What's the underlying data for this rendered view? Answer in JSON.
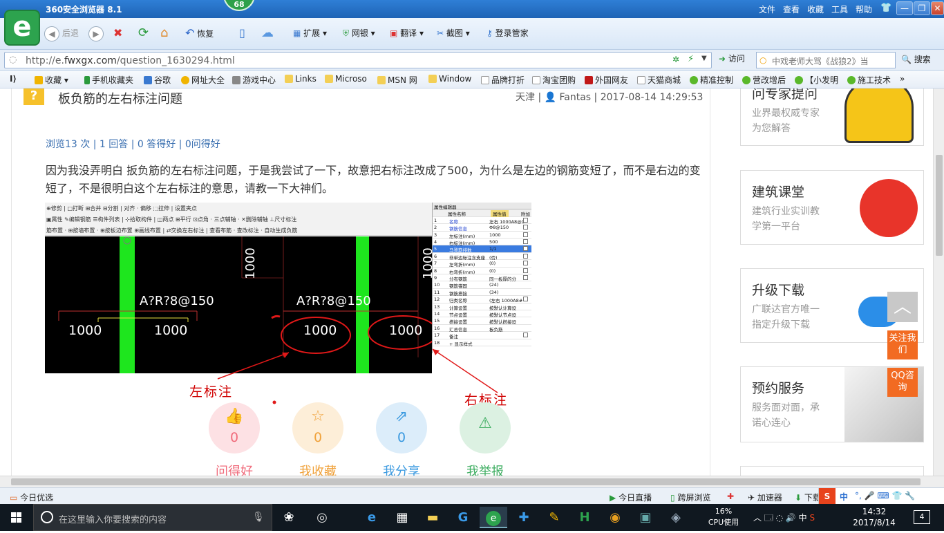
{
  "browser": {
    "title": "360安全浏览器 8.1",
    "badge_count": "68",
    "menu": [
      "文件",
      "查看",
      "收藏",
      "工具",
      "帮助"
    ],
    "toolbar": {
      "back": "后退",
      "restore": "恢复",
      "extensions": "扩展",
      "online_banking": "网银",
      "translate": "翻译",
      "screenshot": "截图",
      "login_manager": "登录管家"
    },
    "address": {
      "url_prefix": "http://e.",
      "url_domain": "fwxgx.com",
      "url_path": "/question_1630294.html",
      "visit_label": "访问",
      "search_placeholder": "中戏老师大骂《战狼2》当",
      "search_button": "搜索"
    },
    "favorites": [
      "收藏",
      "手机收藏夹",
      "谷歌",
      "网址大全",
      "游戏中心",
      "Links",
      "Microso",
      "MSN 网",
      "Window",
      "品牌打折",
      "淘宝团购",
      "外国网友",
      "天猫商城",
      "精准控制",
      "营改增后",
      "【小发明",
      "施工技术"
    ]
  },
  "question": {
    "title": "板负筋的左右标注问题",
    "meta": "天津 | 👤 Fantas | 2017-08-14 14:29:53",
    "stats": "浏览13 次 | 1 回答 | 0 答得好 | 0问得好",
    "body": "因为我没弄明白 扳负筋的左右标注问题，于是我尝试了一下，故意把右标注改成了500，为什么是左边的钢筋变短了，而不是右边的变短了，不是很明白这个左右标注的意思，请教一下大神们。",
    "image": {
      "toolbar_rows": [
        "⊕修剪 | □打断 ⊞合并 ⊟分割 | 对齐 · 偏移 ⬚拉伸 | 设置夹点",
        "▣属性 ✎编辑钢筋 ☰构件列表 | ⊹拾取构件 | ◫两点 ⊞平行 ⊡点角 · 三点辅轴 · ✕删除辅轴 ⊥尺寸标注",
        "筋布置 · ⊞按墙布置 · ⊞按板边布置 ⊞画线布置 | ⇄交换左右标注 | 查看布筋 · 查改标注 · 自动生成负筋"
      ],
      "cad_labels": {
        "rebar_left": "A?R?8@150",
        "rebar_right": "A?R?8@150",
        "vertical_left": "1000",
        "vertical_right": "1000",
        "dim_1": "1000",
        "dim_2": "1000",
        "dim_3": "1000",
        "dim_4": "1000"
      },
      "props_header": "属性编辑器",
      "props_columns": [
        "属性名称",
        "属性值",
        "附加"
      ],
      "props_rows": [
        {
          "n": "1",
          "name": "名称",
          "value": "左右 1000A8@1"
        },
        {
          "n": "2",
          "name": "钢筋信息",
          "value": "Φ8@150"
        },
        {
          "n": "3",
          "name": "左标注(mm)",
          "value": "1000"
        },
        {
          "n": "4",
          "name": "右标注(mm)",
          "value": "500"
        },
        {
          "n": "5",
          "name": "马凳筋排数",
          "value": "1/1"
        },
        {
          "n": "6",
          "name": "非单边标注含支座",
          "value": "(否)"
        },
        {
          "n": "7",
          "name": "左弯折(mm)",
          "value": "(0)"
        },
        {
          "n": "8",
          "name": "右弯折(mm)",
          "value": "(0)"
        },
        {
          "n": "9",
          "name": "分布钢筋",
          "value": "同一板厚的分"
        },
        {
          "n": "10",
          "name": "钢筋锚固",
          "value": "(24)"
        },
        {
          "n": "11",
          "name": "钢筋搭接",
          "value": "(34)"
        },
        {
          "n": "12",
          "name": "归类名称",
          "value": "(左右 1000A8#"
        },
        {
          "n": "13",
          "name": "计算设置",
          "value": "按默认计算设"
        },
        {
          "n": "14",
          "name": "节点设置",
          "value": "按默认节点设"
        },
        {
          "n": "15",
          "name": "搭接设置",
          "value": "按默认搭接设"
        },
        {
          "n": "16",
          "name": "汇总信息",
          "value": "板负筋"
        },
        {
          "n": "17",
          "name": "备注",
          "value": ""
        },
        {
          "n": "18",
          "name": "+ 显示样式",
          "value": ""
        }
      ],
      "annotation_left": "左标注",
      "annotation_right": "右标注"
    },
    "actions": [
      {
        "label": "问得好",
        "count": "0",
        "color": "#f06b7b"
      },
      {
        "label": "我收藏",
        "count": "0",
        "color": "#f0a23b"
      },
      {
        "label": "我分享",
        "count": "0",
        "color": "#3b9ae0"
      },
      {
        "label": "我举报",
        "count": "",
        "color": "#3fae62"
      }
    ]
  },
  "sidebar": {
    "cards": [
      {
        "title": "问专家提问",
        "sub1": "业界最权威专家",
        "sub2": "为您解答"
      },
      {
        "title": "建筑课堂",
        "sub1": "建筑行业实训教",
        "sub2": "学第一平台"
      },
      {
        "title": "升级下载",
        "sub1": "广联达官方唯一",
        "sub2": "指定升级下载"
      },
      {
        "title": "预约服务",
        "sub1": "服务面对面，承",
        "sub2": "诺心连心"
      }
    ],
    "follow": "关注我们",
    "qq": "QQ咨询"
  },
  "statusbar": {
    "left": "今日优选",
    "live": "今日直播",
    "cross_screen": "跨屏浏览",
    "accelerator": "加速器",
    "download": "下载"
  },
  "taskbar": {
    "search_placeholder": "在这里输入你要搜索的内容",
    "cpu_percent": "16%",
    "cpu_label": "CPU使用",
    "ime": "中",
    "time": "14:32",
    "date": "2017/8/14",
    "notifications": "4"
  }
}
